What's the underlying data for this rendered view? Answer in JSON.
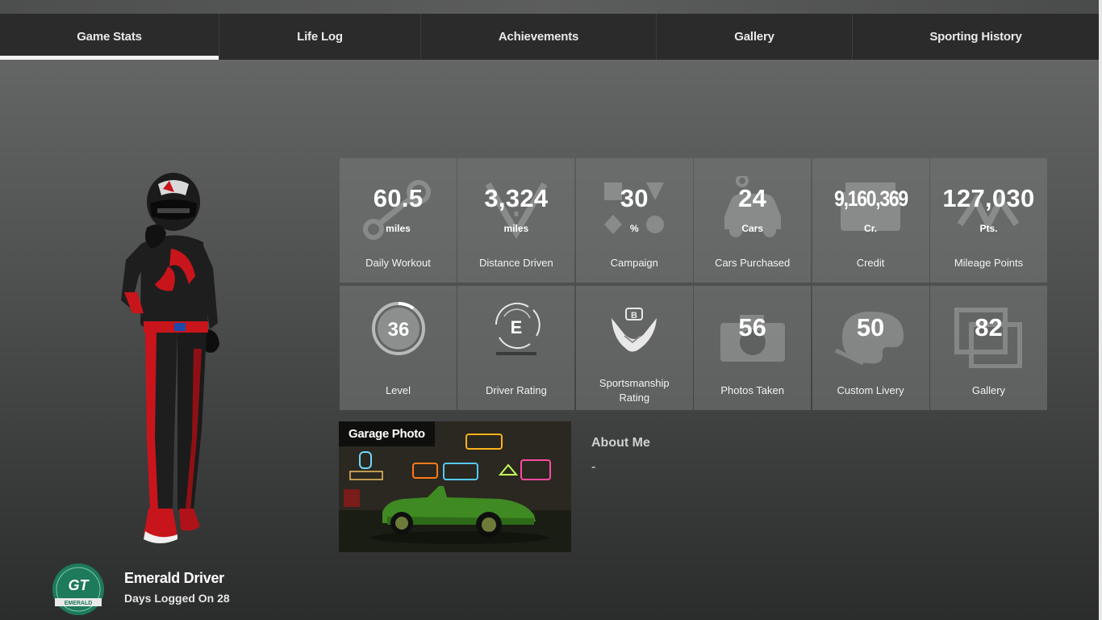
{
  "tabs": [
    {
      "label": "Game Stats",
      "active": true
    },
    {
      "label": "Life Log",
      "active": false
    },
    {
      "label": "Achievements",
      "active": false
    },
    {
      "label": "Gallery",
      "active": false
    },
    {
      "label": "Sporting History",
      "active": false
    }
  ],
  "stats_row1": [
    {
      "value": "60.5",
      "unit": "miles",
      "label": "Daily Workout",
      "icon": "workout-icon"
    },
    {
      "value": "3,324",
      "unit": "miles",
      "label": "Distance Driven",
      "icon": "road-icon"
    },
    {
      "value": "30",
      "unit": "%",
      "label": "Campaign",
      "icon": "campaign-shapes-icon"
    },
    {
      "value": "24",
      "unit": "Cars",
      "label": "Cars Purchased",
      "icon": "car-icon"
    },
    {
      "value": "9,160,369",
      "unit": "Cr.",
      "label": "Credit",
      "icon": "wallet-icon"
    },
    {
      "value": "127,030",
      "unit": "Pts.",
      "label": "Mileage Points",
      "icon": "mileage-icon"
    }
  ],
  "stats_row2": [
    {
      "value": "36",
      "label": "Level",
      "icon": "level-ring-icon",
      "progress": 0.1
    },
    {
      "value": "E",
      "label": "Driver Rating",
      "icon": "driver-rating-icon"
    },
    {
      "value": "B",
      "label": "Sportsmanship Rating",
      "icon": "handshake-icon"
    },
    {
      "value": "56",
      "label": "Photos Taken",
      "icon": "camera-icon"
    },
    {
      "value": "50",
      "label": "Custom Livery",
      "icon": "palette-icon"
    },
    {
      "value": "82",
      "label": "Gallery",
      "icon": "picture-icon"
    }
  ],
  "garage": {
    "title": "Garage Photo"
  },
  "about": {
    "title": "About Me",
    "text": "-"
  },
  "profile": {
    "rank_title": "Emerald Driver",
    "days_logged": "Days Logged On 28",
    "badge_text": "EMERALD"
  },
  "colors": {
    "tab_bg": "#2b2b2b",
    "badge_green": "#1d7a5a",
    "suit_red": "#c8151b"
  }
}
